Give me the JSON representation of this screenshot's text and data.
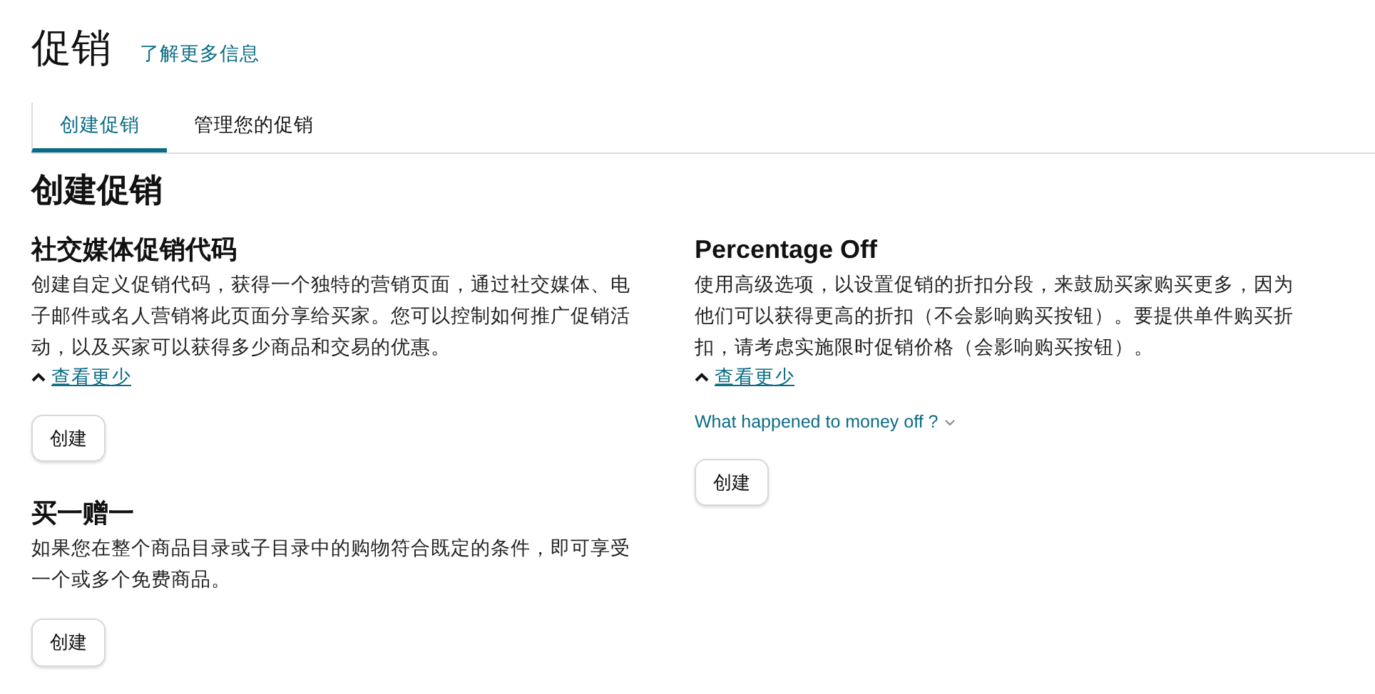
{
  "header": {
    "title": "促销",
    "learn_more_link": "了解更多信息"
  },
  "tabs": [
    {
      "label": "创建促销",
      "selected": true
    },
    {
      "label": "管理您的促销",
      "selected": false
    }
  ],
  "section_title": "创建促销",
  "left_column": [
    {
      "title": "社交媒体促销代码",
      "description": "创建自定义促销代码，获得一个独特的营销页面，通过社交媒体、电子邮件或名人营销将此页面分享给买家。您可以控制如何推广促销活动，以及买家可以获得多少商品和交易的优惠。",
      "toggle_link": "查看更少",
      "expanded": true,
      "button": "创建"
    },
    {
      "title": "买一赠一",
      "description": "如果您在整个商品目录或子目录中的购物符合既定的条件，即可享受一个或多个免费商品。",
      "button": "创建"
    }
  ],
  "right_column": [
    {
      "title": "Percentage Off",
      "description": "使用高级选项，以设置促销的折扣分段，来鼓励买家购买更多，因为他们可以获得更高的折扣（不会影响购买按钮）。要提供单件购买折扣，请考虑实施限时促销价格（会影响购买按钮）。",
      "toggle_link": "查看更少",
      "expanded": true,
      "note_link": "What happened to money off ?",
      "button": "创建"
    }
  ]
}
